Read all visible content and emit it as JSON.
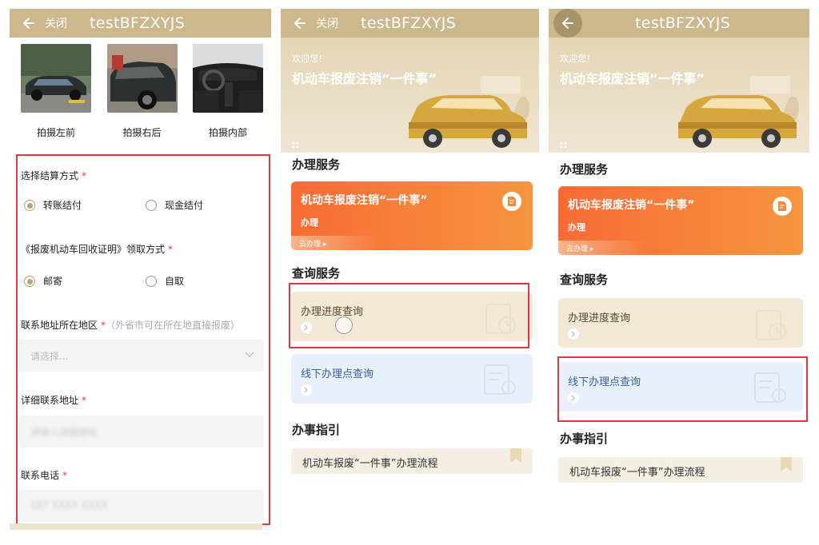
{
  "app_title": "testBFZXYJS",
  "close_label": "关闭",
  "panel1": {
    "photos": [
      {
        "label": "拍摄左前"
      },
      {
        "label": "拍摄右后"
      },
      {
        "label": "拍摄内部"
      }
    ],
    "settlement": {
      "question": "选择结算方式",
      "req": "*",
      "options": [
        "转账结付",
        "现金结付"
      ],
      "selected": "转账结付"
    },
    "certificate": {
      "question": "《报废机动车回收证明》领取方式",
      "req": "*",
      "options": [
        "邮寄",
        "自取"
      ],
      "selected": "邮寄"
    },
    "region": {
      "question": "联系地址所在地区",
      "req": "*",
      "hint": "（外省市可在所在地直接报废）",
      "placeholder": "请选择..."
    },
    "address": {
      "question": "详细联系地址",
      "req": "*",
      "placeholder": "请输入详细地址"
    },
    "phone": {
      "question": "联系电话",
      "req": "*",
      "value": "187 XXXX XXXX"
    }
  },
  "home": {
    "welcome": "欢迎您！",
    "banner_title": "机动车报废注销“一件事”",
    "section_service": "办理服务",
    "service_card": {
      "title": "机动车报废注销“一件事”",
      "subtitle": "办理",
      "go": "去办理 ▸"
    },
    "section_query": "查询服务",
    "query_progress": "办理进度查询",
    "query_offline": "线下办理点查询",
    "section_guide": "办事指引",
    "guide_item": "机动车报废“一件事”办理流程"
  },
  "colors": {
    "header": "#cdb88e",
    "highlight": "#dd3b3b",
    "orange_card": "#f76b35",
    "accent": "#b8a277"
  }
}
